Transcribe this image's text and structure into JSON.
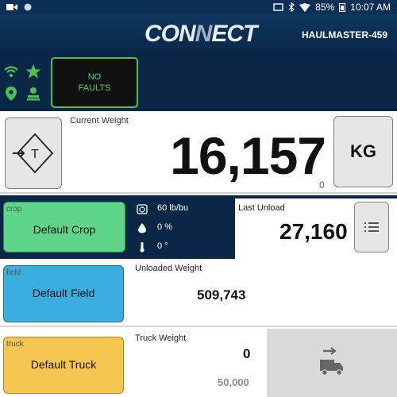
{
  "statusbar": {
    "battery": "85%",
    "time": "10:07 AM"
  },
  "header": {
    "logo_a": "CON",
    "logo_b": "N",
    "logo_c": "ECT",
    "unit_name": "HAULMASTER-459"
  },
  "status": {
    "faults_line1": "NO",
    "faults_line2": "FAULTS"
  },
  "weight": {
    "label": "Current Weight",
    "value": "16,157",
    "small": "0",
    "unit_button": "KG"
  },
  "crop": {
    "tag": "crop",
    "name": "Default Crop",
    "test_weight": "60 lb/bu",
    "moisture": "0 %",
    "temperature": "0 °",
    "last_unload_label": "Last Unload",
    "last_unload_value": "27,160"
  },
  "field": {
    "tag": "field",
    "name": "Default Field",
    "unloaded_label": "Unloaded Weight",
    "unloaded_value": "509,743"
  },
  "truck": {
    "tag": "truck",
    "name": "Default Truck",
    "weight_label": "Truck Weight",
    "weight_value": "0",
    "capacity": "50,000"
  },
  "colors": {
    "accent_green": "#5fd58a",
    "field_blue": "#3aaede",
    "truck_yellow": "#f6c750",
    "navy": "#0a2748"
  }
}
